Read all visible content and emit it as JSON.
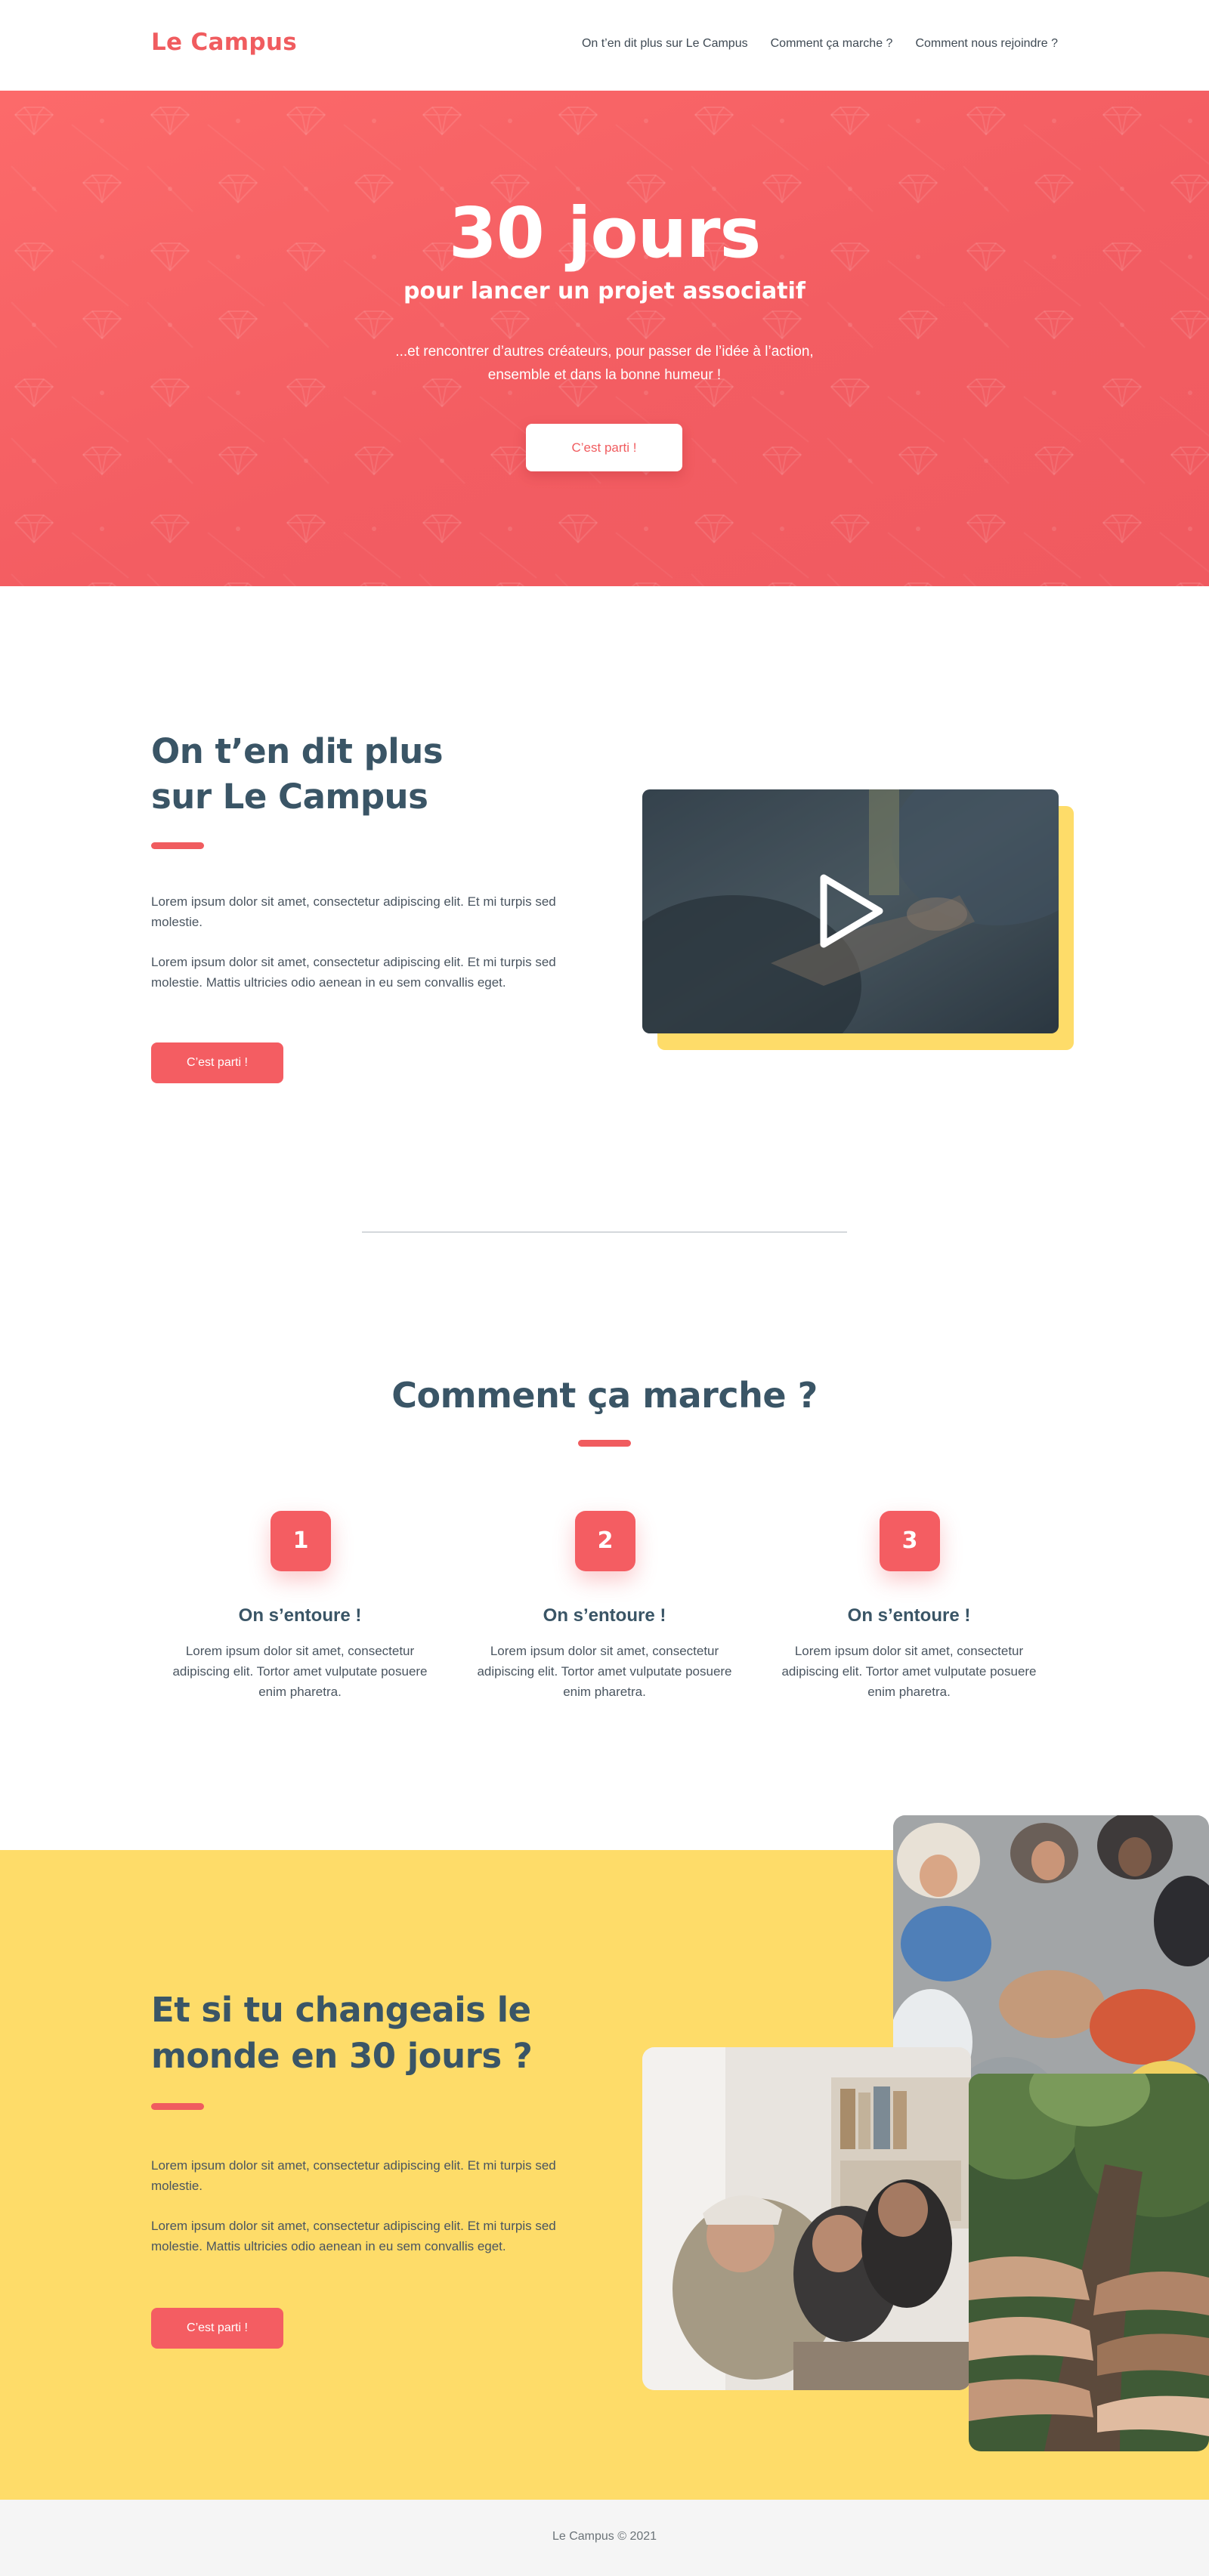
{
  "nav": {
    "logo": "Le Campus",
    "links": [
      "On t’en dit plus sur Le Campus",
      "Comment ça marche ?",
      "Comment nous rejoindre ?"
    ]
  },
  "hero": {
    "title": "30 jours",
    "subtitle": "pour lancer un projet associatif",
    "text": "...et rencontrer d’autres créateurs, pour passer de l’idée à l’action, ensemble et dans la bonne humeur !",
    "button": "C’est parti !"
  },
  "about": {
    "title_line1": "On t’en dit plus",
    "title_line2": "sur Le Campus",
    "paragraph1": "Lorem ipsum dolor sit amet, consectetur adipiscing elit. Et mi turpis sed molestie.",
    "paragraph2": "Lorem ipsum dolor sit amet, consectetur adipiscing elit. Et mi turpis sed molestie. Mattis ultricies odio aenean in eu sem convallis eget.",
    "button": "C’est parti !",
    "video_icon": "play-icon"
  },
  "how": {
    "title": "Comment ça marche ?",
    "steps": [
      {
        "number": "1",
        "title": "On s’entoure !",
        "text": "Lorem ipsum dolor sit amet, consectetur adipiscing elit. Tortor amet vulputate posuere enim pharetra."
      },
      {
        "number": "2",
        "title": "On s’entoure !",
        "text": "Lorem ipsum dolor sit amet, consectetur adipiscing elit. Tortor amet vulputate posuere enim pharetra."
      },
      {
        "number": "3",
        "title": "On s’entoure !",
        "text": "Lorem ipsum dolor sit amet, consectetur adipiscing elit. Tortor amet vulputate posuere enim pharetra."
      }
    ]
  },
  "cta": {
    "title_line1": "Et si tu changeais le",
    "title_line2": "monde en 30 jours ?",
    "paragraph1": "Lorem ipsum dolor sit amet, consectetur adipiscing elit. Et mi turpis sed molestie.",
    "paragraph2": "Lorem ipsum dolor sit amet, consectetur adipiscing elit. Et mi turpis sed molestie. Mattis ultricies odio aenean in eu sem convallis eget.",
    "button": "C’est parti !"
  },
  "footer": {
    "text": "Le Campus © 2021"
  },
  "colors": {
    "brand_red": "#f05c5f",
    "brand_yellow": "#fedc69",
    "heading_navy": "#3a5566"
  }
}
